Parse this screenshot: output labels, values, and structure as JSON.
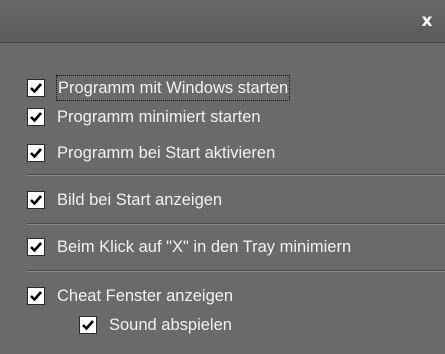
{
  "window": {
    "close_label": "x"
  },
  "options": {
    "start_with_windows": {
      "label": "Programm mit Windows starten",
      "checked": true
    },
    "start_minimized": {
      "label": "Programm minimiert starten",
      "checked": true
    },
    "activate_on_start": {
      "label": "Programm bei Start aktivieren",
      "checked": true
    },
    "show_image_on_start": {
      "label": "Bild bei Start anzeigen",
      "checked": true
    },
    "minimize_to_tray": {
      "label": "Beim Klick auf \"X\" in den Tray minimiern",
      "checked": true
    },
    "show_cheat_window": {
      "label": "Cheat Fenster anzeigen",
      "checked": true
    },
    "play_sound": {
      "label": "Sound abspielen",
      "checked": true
    }
  },
  "colors": {
    "titlebar": "#646464",
    "panel": "#6a6a6a",
    "label_text": "#f2f2f2",
    "checkbox_fill": "#ffffff",
    "checkmark": "#000000"
  }
}
